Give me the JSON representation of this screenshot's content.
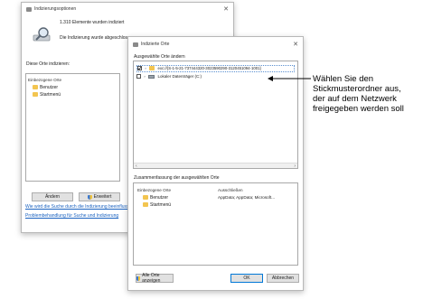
{
  "back_window": {
    "title": "Indizierungsoptionen",
    "indexed_count": "1.310 Elemente wurden indiziert",
    "status": "Die Indizierung wurde abgeschlossen.",
    "locations_label": "Diese Orte indizieren:",
    "column_included": "Einbezogene Orte",
    "items": [
      "Benutzer",
      "Startmenü"
    ],
    "change_button": "Ändern",
    "advanced_button": "Erweitert",
    "link_search": "Wie wird die Suche durch die Indizierung beeinflusst?",
    "link_trouble": "Problembehandlung für Suche und Indizierung"
  },
  "front_window": {
    "title": "Indizierte Orte",
    "change_selected_label": "Ausgewählte Orte ändern",
    "tree_items": [
      {
        "checked": true,
        "label": "exc://{S-1-5-21-737444320-3023590290-3120451094-1001}"
      },
      {
        "checked": false,
        "label": "Lokaler Datenträger (C:)"
      }
    ],
    "summary_label": "Zusammenfassung der ausgewählten Orte",
    "column_included": "Einbezogene Orte",
    "column_excluded": "Ausschließen",
    "summary_items": [
      "Benutzer",
      "Startmenü"
    ],
    "excluded_text": "AppData; AppData; Microsoft...",
    "show_all_button": "Alle Orte anzeigen",
    "ok_button": "OK",
    "cancel_button": "Abbrechen"
  },
  "annotation": {
    "lines": [
      "Wählen Sie den",
      "Stickmusterordner aus,",
      "der auf dem Netzwerk",
      "freigegeben werden soll"
    ]
  }
}
